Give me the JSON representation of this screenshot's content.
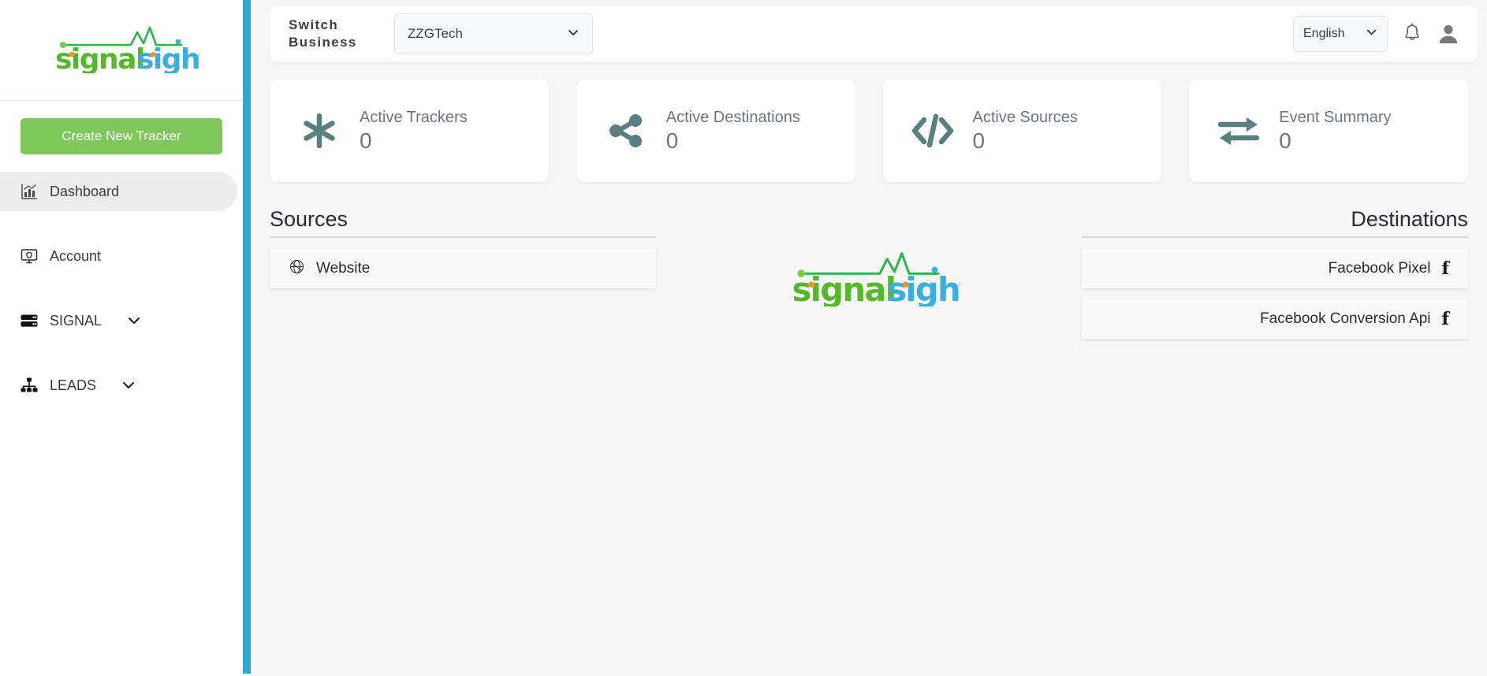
{
  "brand": {
    "logo_part1": "signal",
    "logo_part2": "sight",
    "logo_alt": "signalsight"
  },
  "sidebar": {
    "create_button": "Create New Tracker",
    "items": [
      {
        "label": "Dashboard",
        "icon": "chart-bar-icon",
        "active": true,
        "has_chevron": false
      },
      {
        "label": "Account",
        "icon": "monitor-shield-icon",
        "active": false,
        "has_chevron": false
      },
      {
        "label": "SIGNAL",
        "icon": "server-icon",
        "active": false,
        "has_chevron": true
      },
      {
        "label": "LEADS",
        "icon": "sitemap-icon",
        "active": false,
        "has_chevron": true
      }
    ]
  },
  "topbar": {
    "switch_business_label": "Switch Business",
    "business_value": "ZZGTech",
    "business_options": [
      "ZZGTech"
    ],
    "language_value": "English",
    "language_options": [
      "English"
    ],
    "notification_icon": "bell-icon",
    "account_icon": "user-avatar-icon"
  },
  "cards": [
    {
      "title": "Active Trackers",
      "value": "0",
      "icon": "asterisk-icon"
    },
    {
      "title": "Active Destinations",
      "value": "0",
      "icon": "share-nodes-icon"
    },
    {
      "title": "Active Sources",
      "value": "0",
      "icon": "code-icon"
    },
    {
      "title": "Event Summary",
      "value": "0",
      "icon": "exchange-arrows-icon"
    }
  ],
  "sources": {
    "heading": "Sources",
    "items": [
      {
        "label": "Website",
        "icon": "globe-icon"
      }
    ]
  },
  "destinations": {
    "heading": "Destinations",
    "items": [
      {
        "label": "Facebook Pixel",
        "icon": "facebook-icon"
      },
      {
        "label": "Facebook Conversion Api",
        "icon": "facebook-icon"
      }
    ]
  },
  "colors": {
    "accent_green": "#80c75b",
    "accent_blue": "#2fa8cc",
    "logo_green": "#56b72b",
    "logo_blue": "#3caedc",
    "card_icon": "#5a7f80",
    "card_text": "#6d7484"
  }
}
